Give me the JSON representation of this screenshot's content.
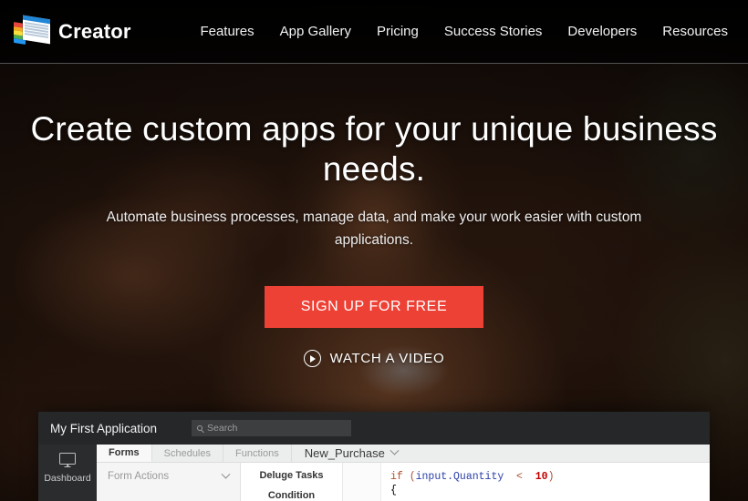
{
  "brand": {
    "name": "Creator",
    "logo_icon": "creator-form-card-icon",
    "logo_stripe_colors": [
      "#e8453c",
      "#f5a623",
      "#f7e03c",
      "#4caf50",
      "#2196f3"
    ]
  },
  "nav": {
    "items": [
      {
        "label": "Features"
      },
      {
        "label": "App Gallery"
      },
      {
        "label": "Pricing"
      },
      {
        "label": "Success Stories"
      },
      {
        "label": "Developers"
      },
      {
        "label": "Resources"
      }
    ]
  },
  "hero": {
    "heading": "Create custom apps for your unique business needs.",
    "subheading": "Automate business processes, manage data, and make your work easier with custom applications.",
    "primary_cta": "SIGN UP FOR FREE",
    "primary_cta_color": "#ee4136",
    "video_link": "WATCH A VIDEO",
    "video_icon": "play-circle-icon"
  },
  "appshot": {
    "title": "My First Application",
    "search_placeholder": "Search",
    "search_icon": "search-icon",
    "sidebar": {
      "icon": "monitor-icon",
      "label": "Dashboard"
    },
    "tabs": [
      {
        "label": "Forms",
        "active": true
      },
      {
        "label": "Schedules",
        "active": false
      },
      {
        "label": "Functions",
        "active": false
      }
    ],
    "form_name": "New_Purchase",
    "form_name_icon": "chevron-down-icon",
    "form_actions": {
      "label": "Form Actions",
      "icon": "chevron-down-icon"
    },
    "task_panel": {
      "heading": "Deluge Tasks",
      "item": "Condition"
    },
    "code": {
      "line1_kw_if": "if",
      "line1_paren_open": " (",
      "line1_var": "input.Quantity",
      "line1_op": "  <  ",
      "line1_num": "10",
      "line1_paren_close": ")",
      "line2": "{"
    }
  }
}
